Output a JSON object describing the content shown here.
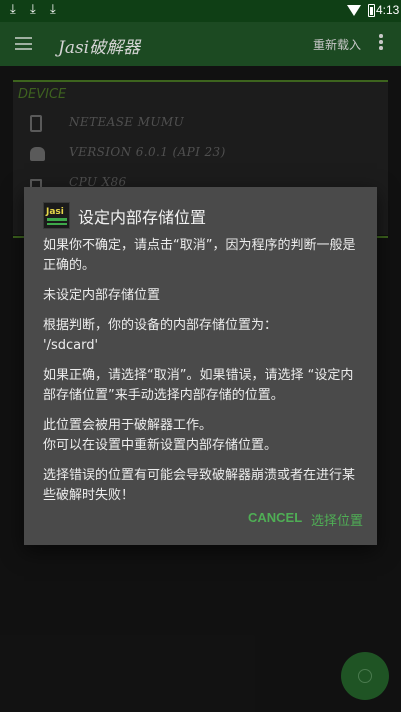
{
  "status_bar": {
    "download_icons": [
      "download-icon",
      "download-icon",
      "download-icon"
    ],
    "time": "4:13"
  },
  "app_bar": {
    "title": "Jasi破解器",
    "reload_label": "重新载入"
  },
  "device_card": {
    "heading": "DEVICE",
    "rows": [
      {
        "icon": "phone-icon",
        "text": "NETEASE MUMU"
      },
      {
        "icon": "android-icon",
        "text": "VERSION 6.0.1 (API 23)"
      },
      {
        "icon": "cpu-icon",
        "text": "CPU X86"
      }
    ]
  },
  "dialog": {
    "title": "设定内部存储位置",
    "paragraphs": [
      "如果你不确定，请点击“取消”，因为程序的判断一般是正确的。",
      "未设定内部存储位置",
      "根据判断，你的设备的内部存储位置为：\n'/sdcard'",
      "如果正确，请选择“取消”。如果错误，请选择 “设定内部存储位置”来手动选择内部存储的位置。",
      "此位置会被用于破解器工作。\n你可以在设置中重新设置内部存储位置。",
      "选择错误的位置有可能会导致破解器崩溃或者在进行某些破解时失败！"
    ],
    "cancel_label": "CANCEL",
    "choose_label": "选择位置"
  },
  "colors": {
    "app_bar": "#1c4a22",
    "accent": "#4fae55",
    "dialog_bg": "#4a4a4a"
  }
}
